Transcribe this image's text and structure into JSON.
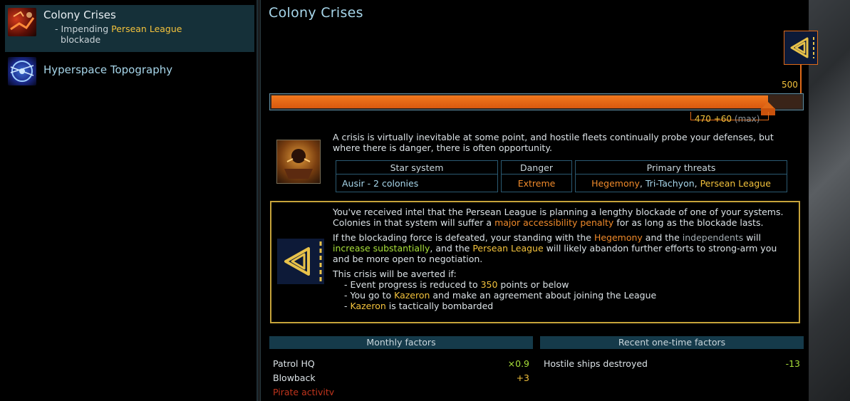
{
  "sidebar": {
    "items": [
      {
        "title": "Colony Crises",
        "sub_prefix": "- Impending ",
        "sub_highlight": "Persean League",
        "sub_suffix": "blockade",
        "icon": "colony-crises-icon"
      },
      {
        "title": "Hyperspace Topography",
        "icon": "hyperspace-topography-icon"
      }
    ]
  },
  "main": {
    "title": "Colony Crises",
    "progress": {
      "value": 470,
      "bonus": "+60",
      "max_label": "(max)",
      "threshold": "500",
      "fraction": 0.94
    },
    "intro": "A crisis is virtually inevitable at some point, and hostile fleets continually probe your defenses, but where there is danger, there is often opportunity.",
    "table": {
      "headers": [
        "Star system",
        "Danger",
        "Primary threats"
      ],
      "row": {
        "system": "Ausir - 2 colonies",
        "danger": "Extreme",
        "threats": [
          "Hegemony",
          "Tri-Tachyon",
          "Persean League"
        ]
      }
    },
    "blockade": {
      "p1_a": "You've received intel that the Persean League is planning a lengthy blockade of one of your systems. Colonies in that system will suffer a ",
      "p1_hl": "major accessibility penalty",
      "p1_b": " for as long as the blockade lasts.",
      "p2_a": "If the blockading force is defeated, your standing with the ",
      "p2_hl1": "Hegemony",
      "p2_b": " and the ",
      "p2_hl2": "independents",
      "p2_c": " will ",
      "p2_hl3": "increase substantially",
      "p2_d": ", and the ",
      "p2_hl4": "Persean League",
      "p2_e": " will likely abandon further efforts to strong-arm you and be more open to negotiation.",
      "p3": "This crisis will be averted if:",
      "c1_a": "- Event progress is reduced to ",
      "c1_hl": "350",
      "c1_b": " points or below",
      "c2_a": "- You go to ",
      "c2_hl": "Kazeron",
      "c2_b": " and make an agreement about joining the League",
      "c3_a": "- ",
      "c3_hl": "Kazeron",
      "c3_b": " is tactically bombarded"
    },
    "monthly": {
      "header": "Monthly factors",
      "rows": [
        {
          "label": "Patrol HQ",
          "value": "×0.9"
        },
        {
          "label": "Blowback",
          "value": "+3"
        },
        {
          "label": "Pirate activity",
          "value": ""
        }
      ]
    },
    "onetime": {
      "header": "Recent one-time factors",
      "rows": [
        {
          "label": "Hostile ships destroyed",
          "value": "-13"
        }
      ]
    }
  },
  "colors": {
    "accent": "#a7d6ea",
    "bar": "#f0781e",
    "gold": "#c6a33a",
    "highlight": "#f3c23c",
    "positive": "#a8e03a"
  }
}
